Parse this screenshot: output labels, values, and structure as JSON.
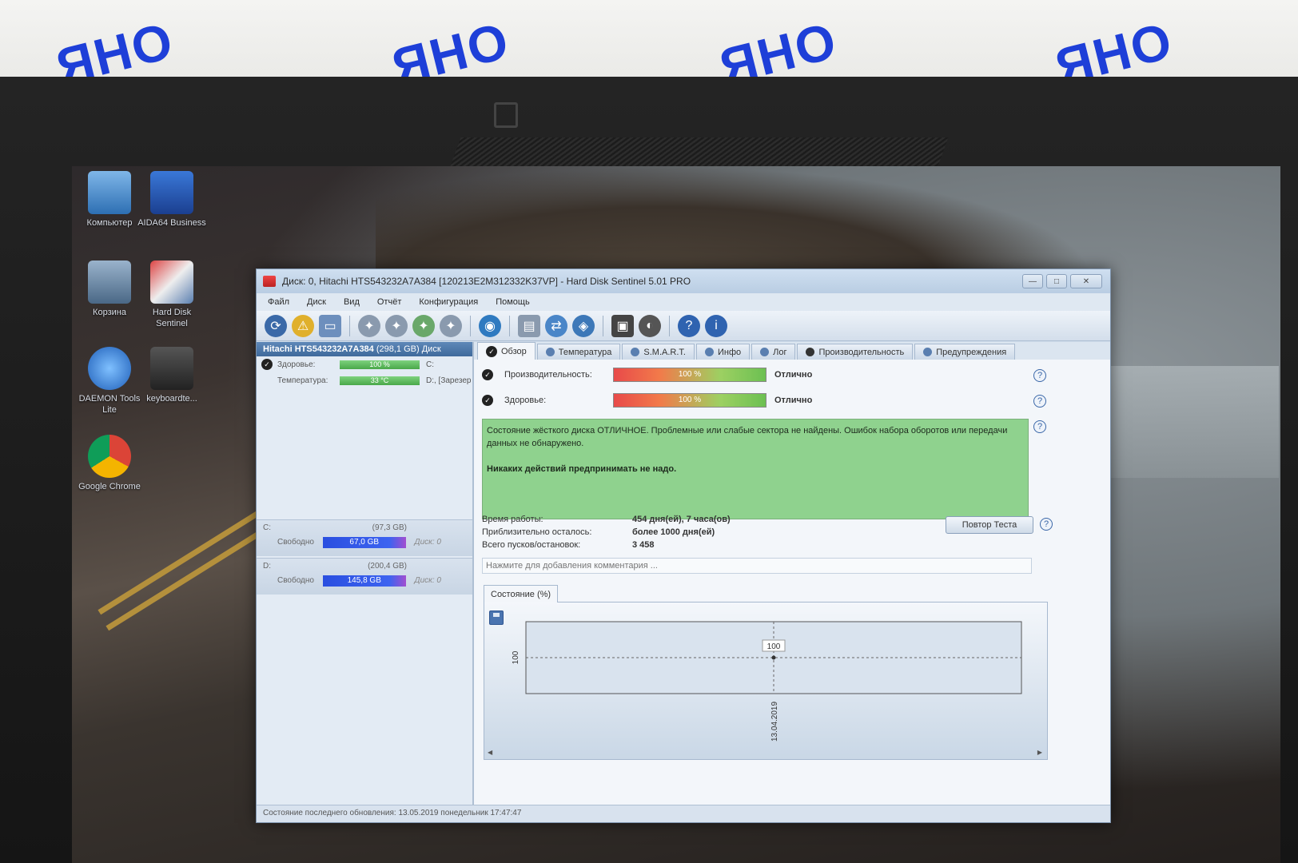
{
  "window": {
    "title": "Диск: 0, Hitachi HTS543232A7A384 [120213E2M312332K37VP]  -  Hard Disk Sentinel 5.01 PRO",
    "min_label": "—",
    "max_label": "□",
    "close_label": "✕"
  },
  "menu": [
    "Файл",
    "Диск",
    "Вид",
    "Отчёт",
    "Конфигурация",
    "Помощь"
  ],
  "desktop": {
    "icons": [
      {
        "label": "Компьютер"
      },
      {
        "label": "AIDA64 Business"
      },
      {
        "label": "Корзина"
      },
      {
        "label": "Hard Disk Sentinel"
      },
      {
        "label": "DAEMON Tools Lite"
      },
      {
        "label": "keyboardte..."
      },
      {
        "label": "Google Chrome"
      }
    ]
  },
  "left_panel": {
    "disk_name": "Hitachi HTS543232A7A384",
    "disk_size": "(298,1 GB)",
    "disk_suffix": "Диск",
    "health_label": "Здоровье:",
    "health_value": "100 %",
    "health_drive": "C:",
    "temp_label": "Температура:",
    "temp_value": "33 °C",
    "temp_drive": "D:, [Зарезер",
    "partitions": [
      {
        "letter": "C:",
        "size": "(97,3 GB)",
        "free_label": "Свободно",
        "free": "67,0 GB",
        "disk": "Диск: 0"
      },
      {
        "letter": "D:",
        "size": "(200,4 GB)",
        "free_label": "Свободно",
        "free": "145,8 GB",
        "disk": "Диск: 0"
      }
    ]
  },
  "tabs": [
    "Обзор",
    "Температура",
    "S.M.A.R.T.",
    "Инфо",
    "Лог",
    "Производительность",
    "Предупреждения"
  ],
  "overview": {
    "performance": {
      "label": "Производительность:",
      "value": "100 %",
      "rating": "Отлично"
    },
    "health": {
      "label": "Здоровье:",
      "value": "100 %",
      "rating": "Отлично"
    },
    "message": "Состояние жёсткого диска ОТЛИЧНОЕ. Проблемные или слабые сектора не найдены. Ошибок набора оборотов или передачи данных не обнаружено.",
    "message_bold": "Никаких действий предпринимать не надо.",
    "uptime_label": "Время работы:",
    "uptime_value": "454 дня(ей), 7 часа(ов)",
    "remaining_label": "Приблизительно осталось:",
    "remaining_value": "более 1000 дня(ей)",
    "starts_label": "Всего пусков/остановок:",
    "starts_value": "3 458",
    "retest_label": "Повтор Теста",
    "comment_placeholder": "Нажмите для добавления комментария ...",
    "chart_tab": "Состояние (%)",
    "help_glyph": "?"
  },
  "status_bar": "Состояние последнего обновления: 13.05.2019 понедельник 17:47:47",
  "chart_data": {
    "type": "line",
    "title": "Состояние (%)",
    "x": [
      "13.04.2019"
    ],
    "series": [
      {
        "values": [
          100
        ]
      }
    ],
    "y_tick_labels": [
      "100"
    ],
    "point_label": "100",
    "grid": true
  },
  "colors": {
    "accent": "#3f6a9c",
    "message_bg": "#8fd28e",
    "bar_low": "#e84a4a",
    "bar_high": "#6cc052",
    "free_bar": "#2a4fe0"
  }
}
